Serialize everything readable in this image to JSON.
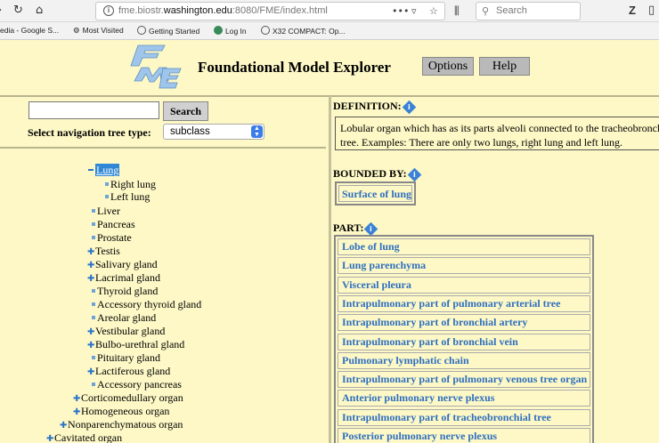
{
  "browser": {
    "url_prefix": "fme.biostr.",
    "url_host": "washington.edu",
    "url_suffix": ":8080/FME/index.html",
    "more_actions": "•••",
    "search_placeholder": "Search",
    "bookmarks": [
      "edia - Google S...",
      "Most Visited",
      "Getting Started",
      "Log In",
      "X32 COMPACT: Op..."
    ]
  },
  "header": {
    "title": "Foundational Model Explorer",
    "options_label": "Options",
    "help_label": "Help"
  },
  "left": {
    "search_value": "",
    "search_button": "Search",
    "type_label": "Select navigation tree type:",
    "type_value": "subclass"
  },
  "tree": [
    {
      "label": "Lung",
      "marker": "minus",
      "selected": true
    },
    {
      "label": "Right lung",
      "marker": "dot"
    },
    {
      "label": "Left lung",
      "marker": "dot"
    },
    {
      "label": "Liver",
      "marker": "dot"
    },
    {
      "label": "Pancreas",
      "marker": "dot"
    },
    {
      "label": "Prostate",
      "marker": "dot"
    },
    {
      "label": "Testis",
      "marker": "plus"
    },
    {
      "label": "Salivary gland",
      "marker": "plus"
    },
    {
      "label": "Lacrimal gland",
      "marker": "plus"
    },
    {
      "label": "Thyroid gland",
      "marker": "dot"
    },
    {
      "label": "Accessory thyroid gland",
      "marker": "dot"
    },
    {
      "label": "Areolar gland",
      "marker": "dot"
    },
    {
      "label": "Vestibular gland",
      "marker": "plus"
    },
    {
      "label": "Bulbo-urethral gland",
      "marker": "plus"
    },
    {
      "label": "Pituitary gland",
      "marker": "dot"
    },
    {
      "label": "Lactiferous gland",
      "marker": "plus"
    },
    {
      "label": "Accessory pancreas",
      "marker": "dot"
    },
    {
      "label": "Corticomedullary organ",
      "marker": "plus"
    },
    {
      "label": "Homogeneous organ",
      "marker": "plus"
    },
    {
      "label": "Nonparenchymatous organ",
      "marker": "plus"
    },
    {
      "label": "Cavitated organ",
      "marker": "plus"
    }
  ],
  "right": {
    "definition_label": "DEFINITION:",
    "definition_text_1": "Lobular organ which has as its parts alveoli connected to the tracheobronchial",
    "definition_text_2": "tree. Examples: There are only two lungs, right lung and left lung.",
    "bounded_label": "BOUNDED BY:",
    "bounded_value": "Surface of lung",
    "part_label": "PART:",
    "parts": [
      "Lobe of lung",
      "Lung parenchyma",
      "Visceral pleura",
      "Intrapulmonary part of pulmonary arterial tree",
      "Intrapulmonary part of bronchial artery",
      "Intrapulmonary part of bronchial vein",
      "Pulmonary lymphatic chain",
      "Intrapulmonary part of pulmonary venous tree organ",
      "Anterior pulmonary nerve plexus",
      "Intrapulmonary part of tracheobronchial tree",
      "Posterior pulmonary nerve plexus"
    ]
  }
}
